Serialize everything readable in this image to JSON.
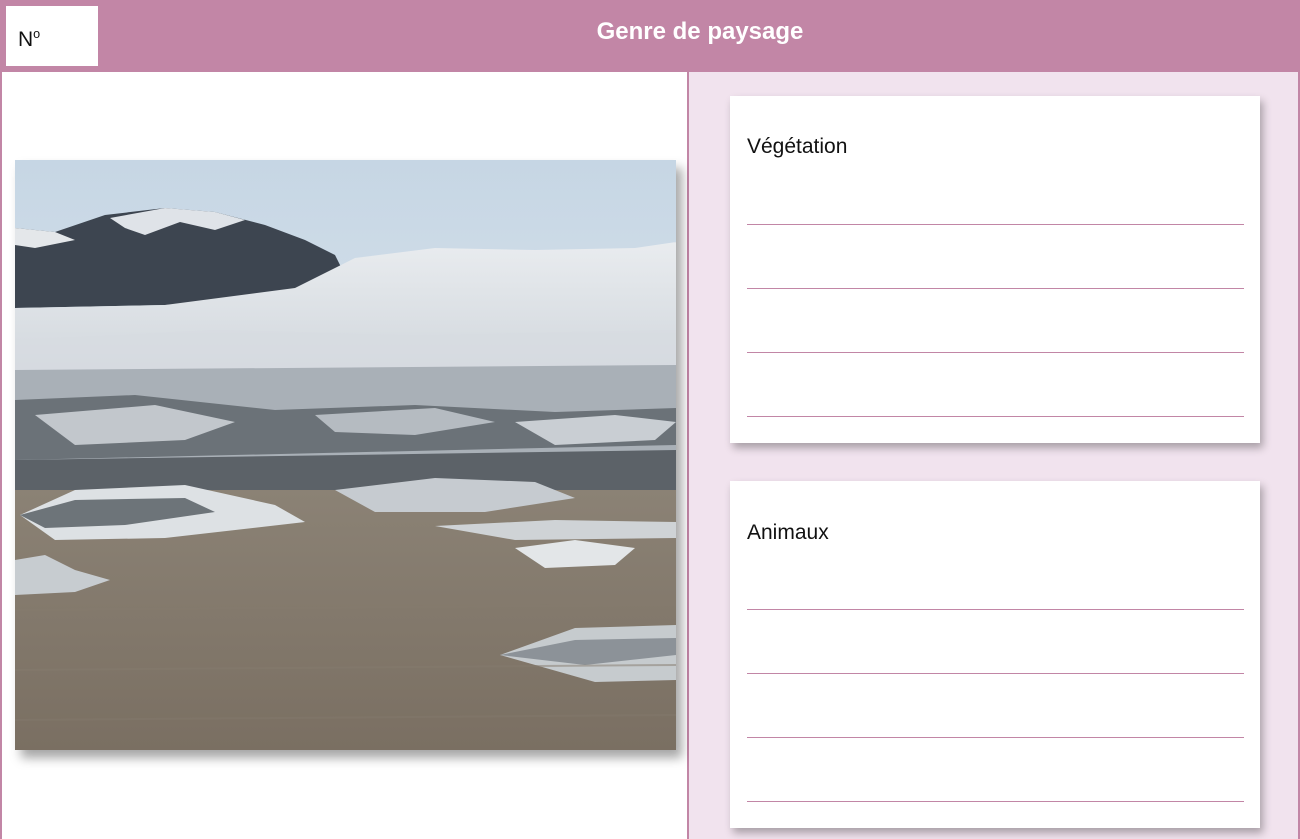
{
  "header": {
    "number_label": "N",
    "number_sup": "o",
    "title": "Genre de paysage"
  },
  "photo": {
    "description_icon": "glacier-landscape-photo"
  },
  "cards": [
    {
      "label": "Végétation",
      "line_count": 4
    },
    {
      "label": "Animaux",
      "line_count": 4
    }
  ],
  "colors": {
    "accent": "#c286a6",
    "panel_bg": "#f1e3ee",
    "header_text": "#ffffff"
  }
}
